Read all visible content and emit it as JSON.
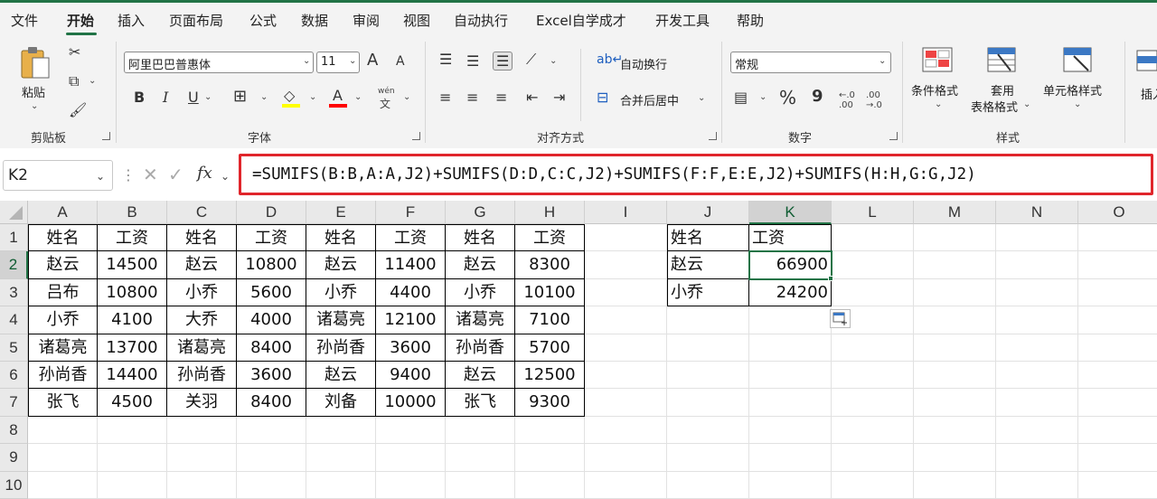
{
  "menu": {
    "items": [
      "文件",
      "开始",
      "插入",
      "页面布局",
      "公式",
      "数据",
      "审阅",
      "视图",
      "自动执行",
      "Excel自学成才",
      "开发工具",
      "帮助"
    ],
    "active": "开始"
  },
  "ribbon": {
    "clipboard": {
      "paste": "粘贴",
      "label": "剪贴板"
    },
    "font": {
      "name": "阿里巴巴普惠体",
      "size": "11",
      "grow": "A",
      "shrink": "A",
      "bold": "B",
      "italic": "I",
      "underline": "U",
      "color_letter": "A",
      "phonetic_top": "wén",
      "phonetic_bottom": "文",
      "label": "字体"
    },
    "alignment": {
      "wrap": "自动换行",
      "merge": "合并后居中",
      "label": "对齐方式"
    },
    "number": {
      "format": "常规",
      "percent": "%",
      "comma": "9",
      "label": "数字"
    },
    "styles": {
      "conditional": "条件格式",
      "table_format_1": "套用",
      "table_format_2": "表格格式",
      "cell_styles": "单元格样式",
      "label": "样式"
    },
    "cells": {
      "insert": "插入"
    }
  },
  "formula_bar": {
    "name_box": "K2",
    "fx": "fx",
    "formula": "=SUMIFS(B:B,A:A,J2)+SUMIFS(D:D,C:C,J2)+SUMIFS(F:F,E:E,J2)+SUMIFS(H:H,G:G,J2)"
  },
  "sheet": {
    "columns": [
      "A",
      "B",
      "C",
      "D",
      "E",
      "F",
      "G",
      "H",
      "I",
      "J",
      "K",
      "L",
      "M",
      "N",
      "O"
    ],
    "selected_column": "K",
    "rows": [
      "1",
      "2",
      "3",
      "4",
      "5",
      "6",
      "7",
      "8",
      "9",
      "10"
    ],
    "selected_row": "2",
    "table": [
      [
        "姓名",
        "工资",
        "姓名",
        "工资",
        "姓名",
        "工资",
        "姓名",
        "工资"
      ],
      [
        "赵云",
        "14500",
        "赵云",
        "10800",
        "赵云",
        "11400",
        "赵云",
        "8300"
      ],
      [
        "吕布",
        "10800",
        "小乔",
        "5600",
        "小乔",
        "4400",
        "小乔",
        "10100"
      ],
      [
        "小乔",
        "4100",
        "大乔",
        "4000",
        "诸葛亮",
        "12100",
        "诸葛亮",
        "7100"
      ],
      [
        "诸葛亮",
        "13700",
        "诸葛亮",
        "8400",
        "孙尚香",
        "3600",
        "孙尚香",
        "5700"
      ],
      [
        "孙尚香",
        "14400",
        "孙尚香",
        "3600",
        "赵云",
        "9400",
        "赵云",
        "12500"
      ],
      [
        "张飞",
        "4500",
        "关羽",
        "8400",
        "刘备",
        "10000",
        "张飞",
        "9300"
      ]
    ],
    "lookup": [
      [
        "姓名",
        "工资"
      ],
      [
        "赵云",
        "66900"
      ],
      [
        "小乔",
        "24200"
      ]
    ]
  },
  "colors": {
    "accent": "#217346",
    "highlight_border": "#e0252b"
  }
}
